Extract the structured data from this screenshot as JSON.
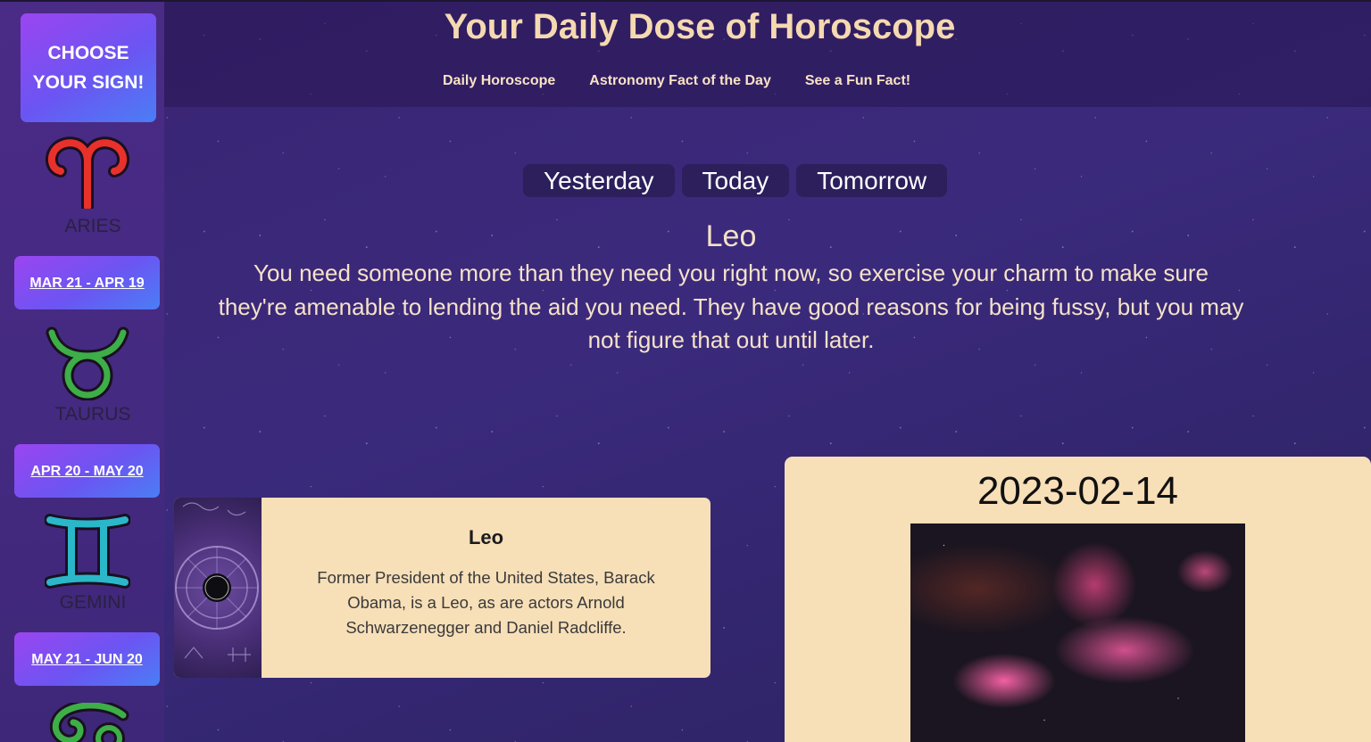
{
  "header": {
    "title": "Your Daily Dose of Horoscope",
    "nav": [
      "Daily Horoscope",
      "Astronomy Fact of the Day",
      "See a Fun Fact!"
    ]
  },
  "sidebar": {
    "choose_label": "CHOOSE YOUR SIGN!",
    "signs": [
      {
        "name": "ARIES",
        "dates": "MAR 21 - APR 19",
        "icon": "aries-icon",
        "color": "#e8312b"
      },
      {
        "name": "TAURUS",
        "dates": "APR 20 - MAY 20",
        "icon": "taurus-icon",
        "color": "#3dae48"
      },
      {
        "name": "GEMINI",
        "dates": "MAY 21 - JUN 20",
        "icon": "gemini-icon",
        "color": "#2ab7c9"
      },
      {
        "name": "",
        "dates": "",
        "icon": "cancer-icon",
        "color": "#3dae48"
      }
    ]
  },
  "horoscope": {
    "tabs": [
      "Yesterday",
      "Today",
      "Tomorrow"
    ],
    "sign": "Leo",
    "text": "You need someone more than they need you right now, so exercise your charm to make sure they're amenable to lending the aid you need. They have good reasons for being fussy, but you may not figure that out until later."
  },
  "fun_fact": {
    "title": "Leo",
    "text": "Former President of the United States, Barack Obama, is a Leo, as are actors Arnold Schwarzenegger and Daniel Radcliffe."
  },
  "apod": {
    "date": "2023-02-14"
  },
  "colors": {
    "title": "#f5d9b0",
    "card": "#f7dfb8",
    "button_gradient_start": "#9b45f0",
    "button_gradient_end": "#4a7ef5"
  }
}
